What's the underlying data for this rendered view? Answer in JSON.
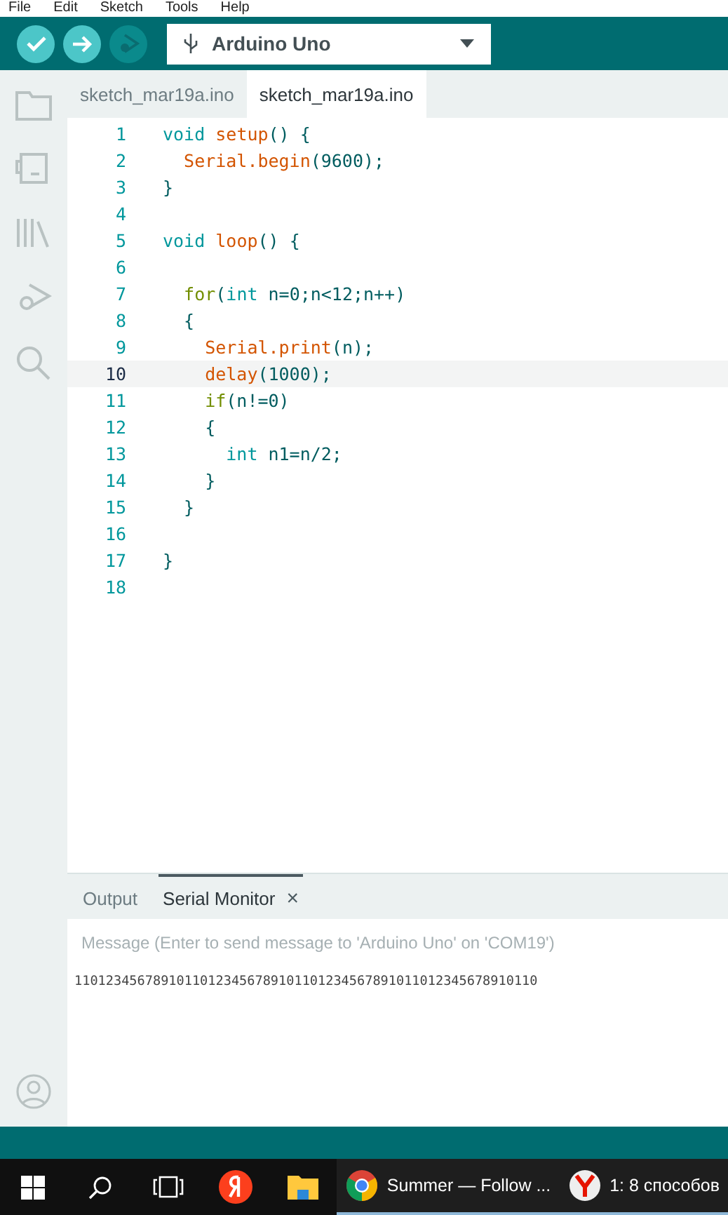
{
  "menu": [
    "File",
    "Edit",
    "Sketch",
    "Tools",
    "Help"
  ],
  "toolbar": {
    "board": "Arduino Uno"
  },
  "tabs": [
    {
      "label": "sketch_mar19a.ino",
      "selected": false
    },
    {
      "label": "sketch_mar19a.ino",
      "selected": true
    }
  ],
  "editor": {
    "lines": [
      {
        "number": "1",
        "current": false,
        "tokens": [
          {
            "text": "void ",
            "kind": "type"
          },
          {
            "text": "setup",
            "kind": "func"
          },
          {
            "text": "() {",
            "kind": "text"
          }
        ]
      },
      {
        "number": "2",
        "current": false,
        "tokens": [
          {
            "text": "  Serial.begin",
            "kind": "func"
          },
          {
            "text": "(9600);",
            "kind": "text"
          }
        ]
      },
      {
        "number": "3",
        "current": false,
        "tokens": [
          {
            "text": "}",
            "kind": "text"
          }
        ]
      },
      {
        "number": "4",
        "current": false
      },
      {
        "number": "5",
        "current": false,
        "tokens": [
          {
            "text": "void ",
            "kind": "type"
          },
          {
            "text": "loop",
            "kind": "func"
          },
          {
            "text": "() {",
            "kind": "text"
          }
        ]
      },
      {
        "number": "6",
        "current": false
      },
      {
        "number": "7",
        "current": false,
        "tokens": [
          {
            "text": "  for",
            "kind": "control"
          },
          {
            "text": "(",
            "kind": "text"
          },
          {
            "text": "int",
            "kind": "type"
          },
          {
            "text": " n=0;n<12;n++)",
            "kind": "text"
          }
        ]
      },
      {
        "number": "8",
        "current": false,
        "tokens": [
          {
            "text": "  {",
            "kind": "text"
          }
        ]
      },
      {
        "number": "9",
        "current": false,
        "tokens": [
          {
            "text": "    Serial.print",
            "kind": "func"
          },
          {
            "text": "(n);",
            "kind": "text"
          }
        ]
      },
      {
        "number": "10",
        "current": true,
        "tokens": [
          {
            "text": "    delay",
            "kind": "func"
          },
          {
            "text": "(1000);",
            "kind": "text"
          }
        ]
      },
      {
        "number": "11",
        "current": false,
        "tokens": [
          {
            "text": "    if",
            "kind": "control"
          },
          {
            "text": "(n!=0)",
            "kind": "text"
          }
        ]
      },
      {
        "number": "12",
        "current": false,
        "tokens": [
          {
            "text": "    {",
            "kind": "text"
          }
        ]
      },
      {
        "number": "13",
        "current": false,
        "tokens": [
          {
            "text": "      int",
            "kind": "type"
          },
          {
            "text": " n1=n/2;",
            "kind": "text"
          }
        ]
      },
      {
        "number": "14",
        "current": false,
        "tokens": [
          {
            "text": "    }",
            "kind": "text"
          }
        ]
      },
      {
        "number": "15",
        "current": false,
        "tokens": [
          {
            "text": "  }",
            "kind": "text"
          }
        ]
      },
      {
        "number": "16",
        "current": false
      },
      {
        "number": "17",
        "current": false,
        "tokens": [
          {
            "text": "}",
            "kind": "text"
          }
        ]
      },
      {
        "number": "18",
        "current": false
      }
    ]
  },
  "panel": {
    "tabs": [
      {
        "label": "Output",
        "selected": false
      },
      {
        "label": "Serial Monitor",
        "selected": true,
        "close": "×"
      }
    ],
    "message": {
      "placeholder": "Message (Enter to send message to 'Arduino Uno' on 'COM19')"
    },
    "output": "11012345678910110123456789101101234567891011012345678910110"
  },
  "taskbar": {
    "apps": [
      {
        "kind": "yandex"
      },
      {
        "kind": "folder"
      },
      {
        "kind": "chrome",
        "label": "Summer — Follow ...",
        "active": true
      },
      {
        "kind": "ybrowser",
        "label": "1: 8 способов",
        "active": true
      }
    ]
  }
}
